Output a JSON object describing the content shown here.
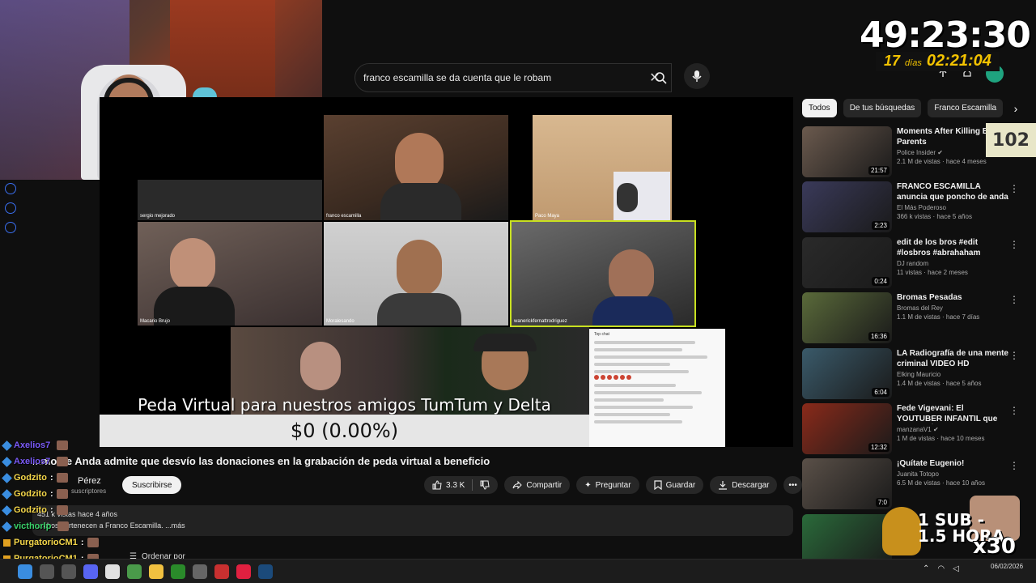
{
  "search": {
    "query": "franco escamilla se da cuenta que le robam"
  },
  "overlay": {
    "timer": "49:23:30",
    "days_count": "17",
    "days_label": "días",
    "countdown": "02:21:04",
    "viewer_count": "102",
    "sub_promo": "1 SUB -\n1.5 HORA",
    "multiplier": "x30"
  },
  "player": {
    "tiles": [
      {
        "label": "sergio mejorado"
      },
      {
        "label": "franco escamilla"
      },
      {
        "label": "Paco Maya"
      },
      {
        "label": "Macario Brujo"
      },
      {
        "label": "Moralesando"
      },
      {
        "label": "wanerickfernattrodriguez"
      }
    ],
    "banner": "Peda Virtual para nuestros amigos TumTum y Delta",
    "donation_total": "$0 (0.00%)",
    "donation_progress": 0.0,
    "chat_title": "Top chat"
  },
  "chips": [
    "Todos",
    "De tus búsquedas",
    "Franco Escamilla"
  ],
  "recommendations": [
    {
      "title": "Moments After Killing Both Parents",
      "channel": "Police Insider",
      "meta": "2.1 M de vistas · hace 4 meses",
      "duration": "21:57",
      "color": "#6b5a4e",
      "verified": true
    },
    {
      "title": "FRANCO ESCAMILLA anuncia que poncho de anda ESTA ...",
      "channel": "El Más Poderoso",
      "meta": "366 k vistas · hace 5 años",
      "duration": "2:23",
      "color": "#3a3a5a",
      "verified": false
    },
    {
      "title": "edit de los bros #edit #losbros #abrahaham",
      "channel": "DJ random",
      "meta": "11 vistas · hace 2 meses",
      "duration": "0:24",
      "color": "#2a2a2a",
      "verified": false
    },
    {
      "title": "Bromas Pesadas",
      "channel": "Bromas del Rey",
      "meta": "1.1 M de vistas · hace 7 días",
      "duration": "16:36",
      "color": "#5a6a3a",
      "verified": false
    },
    {
      "title": "LA Radiografía de una mente criminal VIDEO HD",
      "channel": "Elking Mauricio",
      "meta": "1.4 M de vistas · hace 5 años",
      "duration": "6:04",
      "color": "#3a5a6a",
      "verified": false
    },
    {
      "title": "Fede Vigevani: El YOUTUBER INFANTIL que RESULTÓ ser un...",
      "channel": "manzanaV1",
      "meta": "1 M de vistas · hace 10 meses",
      "duration": "12:32",
      "color": "#8a2a1a",
      "verified": true
    },
    {
      "title": "¡Quítate Eugenio!",
      "channel": "Juanita Totopo",
      "meta": "6.5 M de vistas · hace 10 años",
      "duration": "7:0",
      "color": "#5a5048",
      "verified": false
    },
    {
      "title": "",
      "channel": "",
      "meta": "",
      "duration": "",
      "color": "#2a6a3a",
      "verified": false
    }
  ],
  "video": {
    "title": "...mo de Anda admite que desvío las donaciones en la grabación de peda virtual a beneficio",
    "channel": "Pérez",
    "subs": "suscriptores",
    "subscribe_label": "Suscribirse",
    "likes": "3.3 K",
    "share_label": "Compartir",
    "ask_label": "Preguntar",
    "save_label": "Guardar",
    "download_label": "Descargar",
    "views": "451 k vistas  hace 4 años",
    "description": "...chos pertenecen a Franco Escamilla. ...más",
    "sort_label": "Ordenar por"
  },
  "overlay_chat": [
    {
      "user": "Axelios7",
      "msg": "",
      "color": "#7a5af8"
    },
    {
      "user": "Axelios7",
      "msg": "",
      "color": "#7a5af8"
    },
    {
      "user": "Godzito",
      "msg": ":",
      "color": "#f5d74a"
    },
    {
      "user": "Godzito",
      "msg": ":",
      "color": "#f5d74a"
    },
    {
      "user": "Godzito",
      "msg": ":",
      "color": "#f5d74a"
    },
    {
      "user": "victhorlp",
      "msg": "",
      "color": "#3ad26a"
    },
    {
      "user": "PurgatorioCM1",
      "msg": ":",
      "color": "#f5d74a"
    },
    {
      "user": "PurgatorioCM1",
      "msg": ":",
      "color": "#f5d74a"
    },
    {
      "user": "PurgatorioCM1",
      "msg": ":",
      "color": "#f5d74a"
    }
  ],
  "taskbar": {
    "time": "",
    "date": "06/02/2026",
    "apps": [
      {
        "name": "start-icon",
        "color": "#3a8de0"
      },
      {
        "name": "search-icon",
        "color": "#555"
      },
      {
        "name": "taskview-icon",
        "color": "#555"
      },
      {
        "name": "discord-icon",
        "color": "#5865f2"
      },
      {
        "name": "store-icon",
        "color": "#e0e0e0"
      },
      {
        "name": "chrome-icon",
        "color": "#4a9a4a"
      },
      {
        "name": "explorer-icon",
        "color": "#f0c040"
      },
      {
        "name": "xbox-icon",
        "color": "#2a8a2a"
      },
      {
        "name": "app-icon",
        "color": "#666"
      },
      {
        "name": "app-red-icon",
        "color": "#c83030"
      },
      {
        "name": "opera-icon",
        "color": "#e02040"
      },
      {
        "name": "steam-icon",
        "color": "#1b4a7a"
      }
    ]
  }
}
